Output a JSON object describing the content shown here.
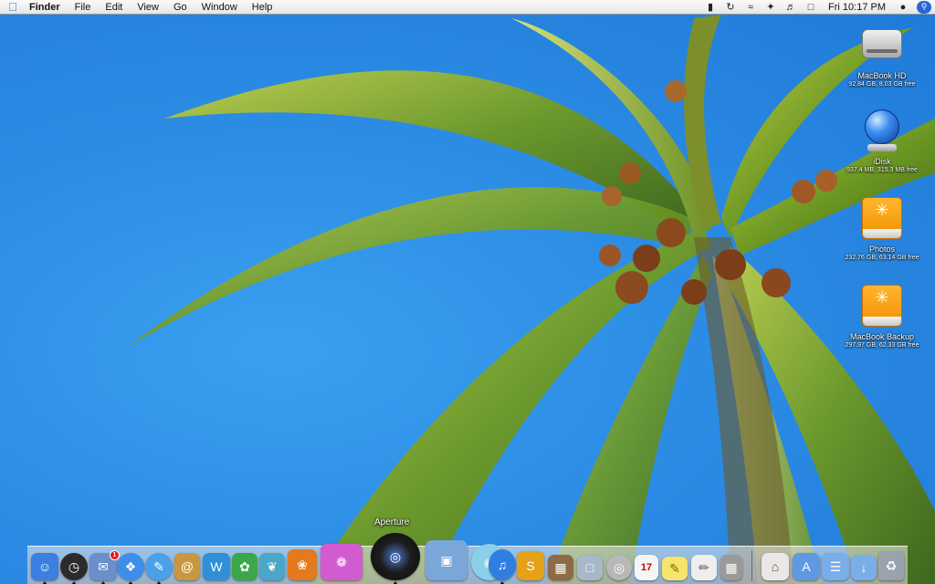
{
  "menubar": {
    "app_name": "Finder",
    "menus": [
      "File",
      "Edit",
      "View",
      "Go",
      "Window",
      "Help"
    ],
    "clock": "Fri 10:17 PM",
    "status_icons": [
      "battery-icon",
      "sync-icon",
      "wifi-icon",
      "bluetooth-icon",
      "volume-icon",
      "display-icon"
    ]
  },
  "desktop": {
    "icons": [
      {
        "name": "MacBook HD",
        "info": "92.84 GB, 8.03 GB free",
        "icon": "hard-drive-icon"
      },
      {
        "name": "iDisk",
        "info": "937.4 MB, 315.3 MB free",
        "icon": "idisk-icon"
      },
      {
        "name": "Photos",
        "info": "232.76 GB, 63.14 GB free",
        "icon": "firewire-drive-icon"
      },
      {
        "name": "MacBook Backup",
        "info": "297.97 GB, 62.33 GB free",
        "icon": "firewire-drive-icon"
      }
    ]
  },
  "dock": {
    "tooltip": "Aperture",
    "mail_badge": "1",
    "calendar_date": "17",
    "items": [
      {
        "name": "Finder",
        "icon": "finder-icon",
        "color": "#3b7fe0"
      },
      {
        "name": "Dashboard",
        "icon": "dashboard-icon",
        "color": "#2b2b2b"
      },
      {
        "name": "Mail",
        "icon": "mail-icon",
        "color": "#6a8fc9"
      },
      {
        "name": "Safari",
        "icon": "safari-icon",
        "color": "#3d8ee8"
      },
      {
        "name": "iChat",
        "icon": "ichat-icon",
        "color": "#4aa1ea"
      },
      {
        "name": "Address Book",
        "icon": "address-book-icon",
        "color": "#c8973e"
      },
      {
        "name": "iWeb",
        "icon": "iweb-icon",
        "color": "#2f8fd8"
      },
      {
        "name": "App",
        "icon": "green-app-icon",
        "color": "#3aa84a"
      },
      {
        "name": "Feather App",
        "icon": "feather-icon",
        "color": "#49a7c9"
      },
      {
        "name": "App",
        "icon": "orange-app-icon",
        "color": "#e47a1c"
      },
      {
        "name": "Butterfly App",
        "icon": "butterfly-icon",
        "color": "#d35bd2"
      },
      {
        "name": "Aperture",
        "icon": "aperture-icon",
        "color": "#1d1d1d"
      },
      {
        "name": "iPhoto",
        "icon": "iphoto-icon",
        "color": "#7aa6d8"
      },
      {
        "name": "DVD Player",
        "icon": "dvd-icon",
        "color": "#8ad0ea"
      },
      {
        "name": "iTunes",
        "icon": "itunes-icon",
        "color": "#2f7fe0"
      },
      {
        "name": "Sandvox",
        "icon": "sandvox-icon",
        "color": "#e3a21a"
      },
      {
        "name": "Preview",
        "icon": "preview-icon",
        "color": "#8c6b46"
      },
      {
        "name": "App",
        "icon": "box-app-icon",
        "color": "#a8b8c8"
      },
      {
        "name": "Disc App",
        "icon": "disc-app-icon",
        "color": "#b8b8b8"
      },
      {
        "name": "iCal",
        "icon": "ical-icon",
        "color": "#f5f5f5"
      },
      {
        "name": "Stickies",
        "icon": "stickies-icon",
        "color": "#f6e56b"
      },
      {
        "name": "TextEdit",
        "icon": "textedit-icon",
        "color": "#eeeeee"
      },
      {
        "name": "Calculator",
        "icon": "calculator-icon",
        "color": "#9a9a9a"
      },
      {
        "name": "Home",
        "icon": "home-folder-icon",
        "color": "#e8e8e8"
      },
      {
        "name": "Applications",
        "icon": "applications-folder-icon",
        "color": "#5e9ae4"
      },
      {
        "name": "Documents",
        "icon": "documents-folder-icon",
        "color": "#7aaee8"
      },
      {
        "name": "Downloads",
        "icon": "downloads-folder-icon",
        "color": "#7aaee8"
      },
      {
        "name": "Trash",
        "icon": "trash-icon",
        "color": "#9aa3ad"
      }
    ]
  }
}
